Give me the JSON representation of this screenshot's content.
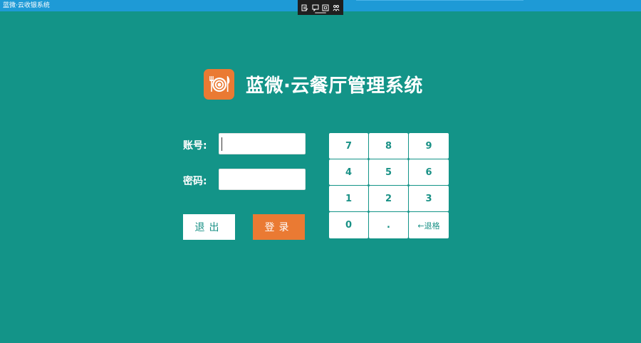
{
  "window": {
    "title": "蓝微·云收银系统"
  },
  "header": {
    "title": "蓝微·云餐厅管理系统",
    "logo_icon": "plate-fork-knife-icon",
    "logo_color": "#ea7a33"
  },
  "login_form": {
    "account_label": "账号:",
    "account_value": "",
    "password_label": "密码:",
    "password_value": ""
  },
  "actions": {
    "exit_label": "退出",
    "login_label": "登录"
  },
  "keypad": {
    "keys": [
      "7",
      "8",
      "9",
      "4",
      "5",
      "6",
      "1",
      "2",
      "3",
      "0",
      ".",
      "←退格"
    ]
  },
  "colors": {
    "background": "#139488",
    "titlebar": "#1e9ad6",
    "accent": "#ea7a33",
    "key_text": "#1a9186"
  }
}
